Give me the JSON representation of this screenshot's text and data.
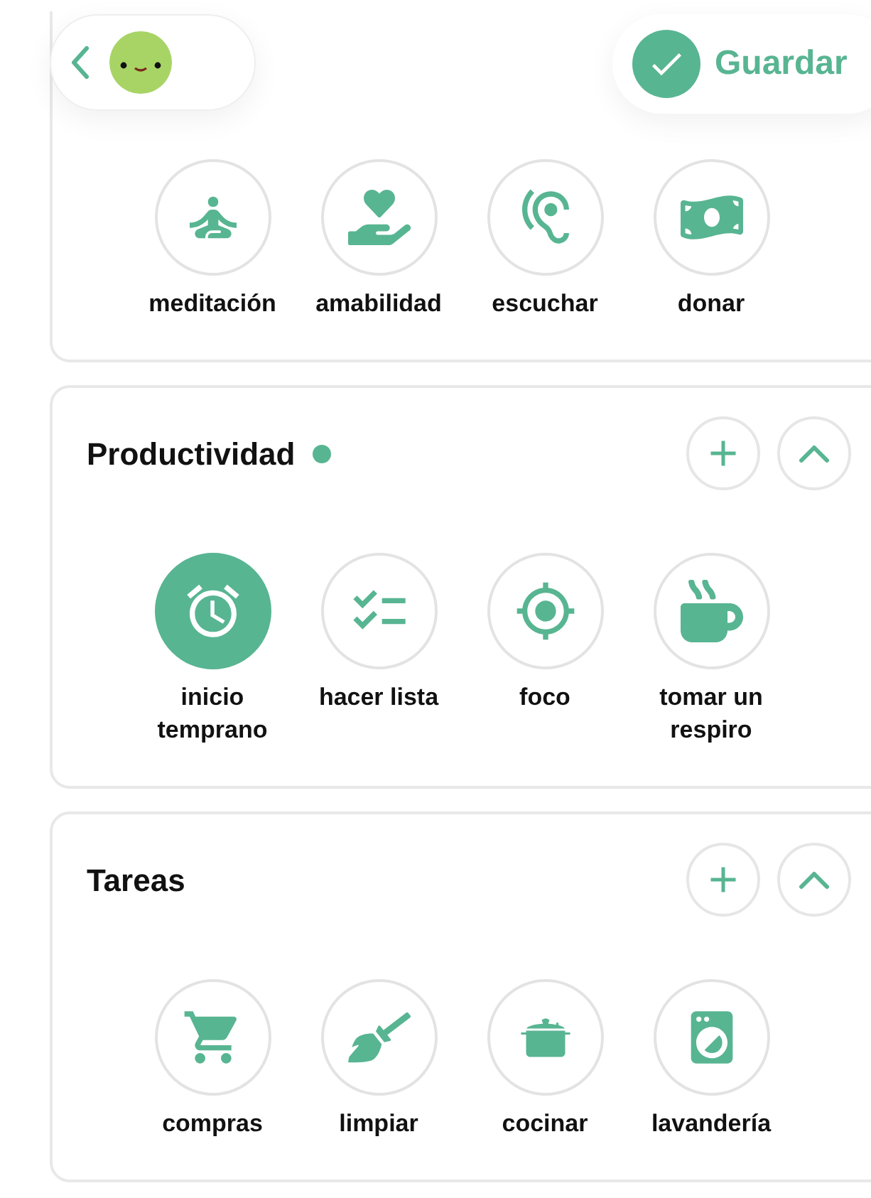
{
  "header": {
    "save": "Guardar"
  },
  "sections": [
    {
      "items": [
        {
          "label": "meditación",
          "selected": false
        },
        {
          "label": "amabilidad",
          "selected": false
        },
        {
          "label": "escuchar",
          "selected": false
        },
        {
          "label": "donar",
          "selected": false
        }
      ]
    },
    {
      "title": "Productividad",
      "marked": true,
      "expanded": true,
      "items": [
        {
          "label": "inicio temprano",
          "selected": true
        },
        {
          "label": "hacer lista",
          "selected": false
        },
        {
          "label": "foco",
          "selected": false
        },
        {
          "label": "tomar un respiro",
          "selected": false
        }
      ]
    },
    {
      "title": "Tareas",
      "marked": false,
      "expanded": true,
      "items": [
        {
          "label": "compras",
          "selected": false
        },
        {
          "label": "limpiar",
          "selected": false
        },
        {
          "label": "cocinar",
          "selected": false
        },
        {
          "label": "lavandería",
          "selected": false
        }
      ]
    }
  ]
}
